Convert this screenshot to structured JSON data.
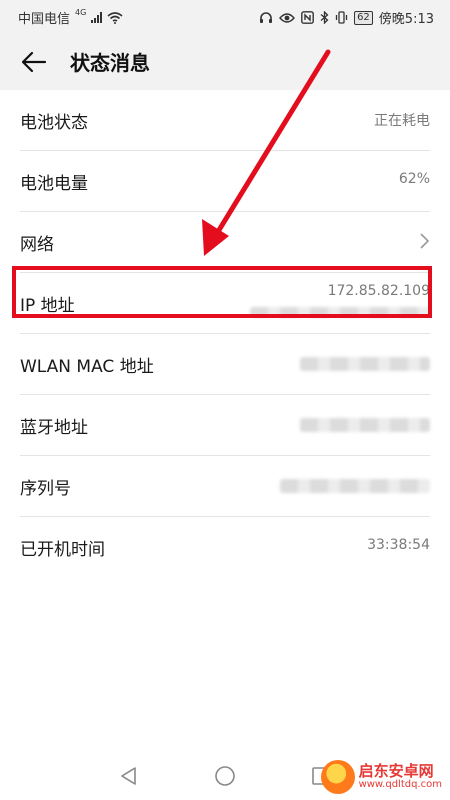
{
  "status_bar": {
    "carrier": "中国电信",
    "network": "4G",
    "battery": "62",
    "time": "傍晚5:13"
  },
  "app_bar": {
    "title": "状态消息"
  },
  "rows": {
    "battery_status": {
      "label": "电池状态",
      "value": "正在耗电"
    },
    "battery_level": {
      "label": "电池电量",
      "value": "62%"
    },
    "network": {
      "label": "网络"
    },
    "ip_address": {
      "label": "IP 地址",
      "value": "172.85.82.109"
    },
    "wlan_mac": {
      "label": "WLAN MAC 地址"
    },
    "bluetooth": {
      "label": "蓝牙地址"
    },
    "serial": {
      "label": "序列号"
    },
    "uptime": {
      "label": "已开机时间",
      "value": "33:38:54"
    }
  },
  "annotation": {
    "color": "#e30d1d"
  },
  "watermark": {
    "name": "启东安卓网",
    "url": "www.qdltdq.com"
  }
}
